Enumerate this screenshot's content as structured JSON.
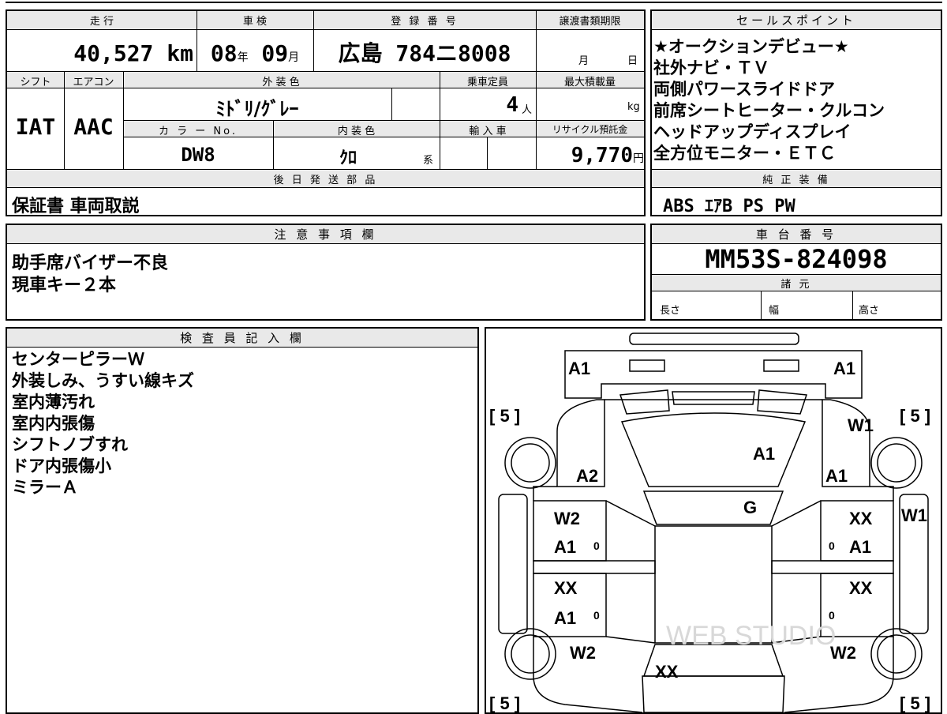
{
  "top_form": {
    "mileage_label": "走 行",
    "mileage_value": "40,527",
    "mileage_unit": "km",
    "inspection_label": "車 検",
    "inspection_year": "08",
    "inspection_year_unit": "年",
    "inspection_month": "09",
    "inspection_month_unit": "月",
    "registration_label": "登 録 番 号",
    "registration_region": "広島",
    "registration_class": "784",
    "registration_kana": "ニ",
    "registration_number": "8008",
    "transfer_deadline_label": "譲渡書類期限",
    "transfer_month_unit": "月",
    "transfer_day_unit": "日",
    "shift_label": "シフト",
    "shift_value": "IAT",
    "aircon_label": "エアコン",
    "aircon_value": "AAC",
    "exterior_color_label": "外 装 色",
    "exterior_color_value": "ﾐﾄﾞﾘ/ｸﾞﾚｰ",
    "capacity_label": "乗車定員",
    "capacity_value": "4",
    "capacity_unit": "人",
    "max_load_label": "最大積載量",
    "max_load_unit": "kg",
    "color_no_label": "カ ラ ー No.",
    "color_no_value": "DW8",
    "interior_color_label": "内 装 色",
    "interior_color_value": "ｸﾛ",
    "interior_color_suffix": "系",
    "import_label": "輸 入 車",
    "recycle_label": "リサイクル預託金",
    "recycle_value": "9,770",
    "recycle_unit": "円",
    "later_parts_label": "後 日 発 送 部 品",
    "later_parts_value": "保証書 車両取説"
  },
  "sales_points": {
    "title": "セールスポイント",
    "items": [
      "★オークションデビュー★",
      "社外ナビ・ＴＶ",
      "両側パワースライドドア",
      "前席シートヒーター・クルコン",
      "ヘッドアップディスプレイ",
      "全方位モニター・ＥＴＣ"
    ]
  },
  "genuine_equipment": {
    "title": "純 正 装 備",
    "value": "ABS ｴｱB PS PW"
  },
  "notes": {
    "title": "注 意 事 項 欄",
    "lines": [
      "助手席バイザー不良",
      "現車キー２本"
    ]
  },
  "chassis": {
    "title": "車 台 番 号",
    "value": "MM53S-824098"
  },
  "specs": {
    "title": "諸 元",
    "length_label": "長さ",
    "width_label": "幅",
    "height_label": "高さ"
  },
  "inspector": {
    "title": "検 査 員 記 入 欄",
    "lines": [
      "センターピラーＷ",
      "外装しみ、うすい線キズ",
      "室内薄汚れ",
      "室内内張傷",
      "シフトノブすれ",
      "ドア内張傷小",
      "ミラーＡ"
    ]
  },
  "diagram": {
    "tire_front_left": "[ 5 ]",
    "tire_front_right": "[ 5 ]",
    "tire_rear_left": "[ 5 ]",
    "tire_rear_right": "[ 5 ]",
    "front_bumper_left": "A1",
    "front_bumper_right": "A1",
    "hood": "A1",
    "front_fender_left": "A2",
    "front_fender_right": "A1",
    "front_fender_right_top": "W1",
    "windshield": "G",
    "right_mirror": "W1",
    "front_door_left_1": "W2",
    "front_door_left_2": "A1",
    "front_door_right_1": "XX",
    "front_door_right_2": "A1",
    "rear_door_left_1": "XX",
    "rear_door_left_2": "A1",
    "rear_door_right_1": "XX",
    "rear_quarter_left": "W2",
    "rear_quarter_right": "W2",
    "back_door": "XX",
    "zero_mark": "0",
    "watermark": "WEB STUDIO"
  }
}
